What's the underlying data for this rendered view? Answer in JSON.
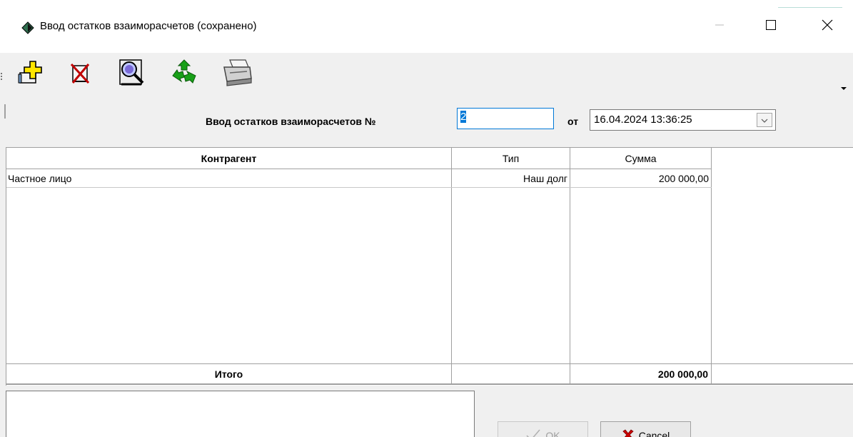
{
  "window": {
    "title": "Ввод остатков взаиморасчетов (сохранено)",
    "controls": {
      "minimize_icon": "minimize-icon",
      "maximize_icon": "maximize-icon",
      "close_icon": "close-icon"
    }
  },
  "toolbar": {
    "buttons": [
      {
        "name": "add-document-icon"
      },
      {
        "name": "delete-document-icon"
      },
      {
        "name": "preview-icon"
      },
      {
        "name": "refresh-icon"
      },
      {
        "name": "print-icon"
      }
    ]
  },
  "header": {
    "label": "Ввод остатков взаиморасчетов №",
    "number": "2",
    "from_label": "от",
    "date": "16.04.2024 13:36:25"
  },
  "grid": {
    "columns": [
      "Контрагент",
      "Тип",
      "Сумма"
    ],
    "rows": [
      {
        "counterparty": "Частное лицо",
        "type": "Наш долг",
        "amount": "200 000,00"
      }
    ],
    "footer": {
      "label": "Итого",
      "type": "",
      "total": "200 000,00"
    }
  },
  "buttons": {
    "ok_label": "OK",
    "cancel_label": "Cancel"
  },
  "colors": {
    "accent": "#0078d7",
    "cancel_icon": "#cc0000"
  }
}
